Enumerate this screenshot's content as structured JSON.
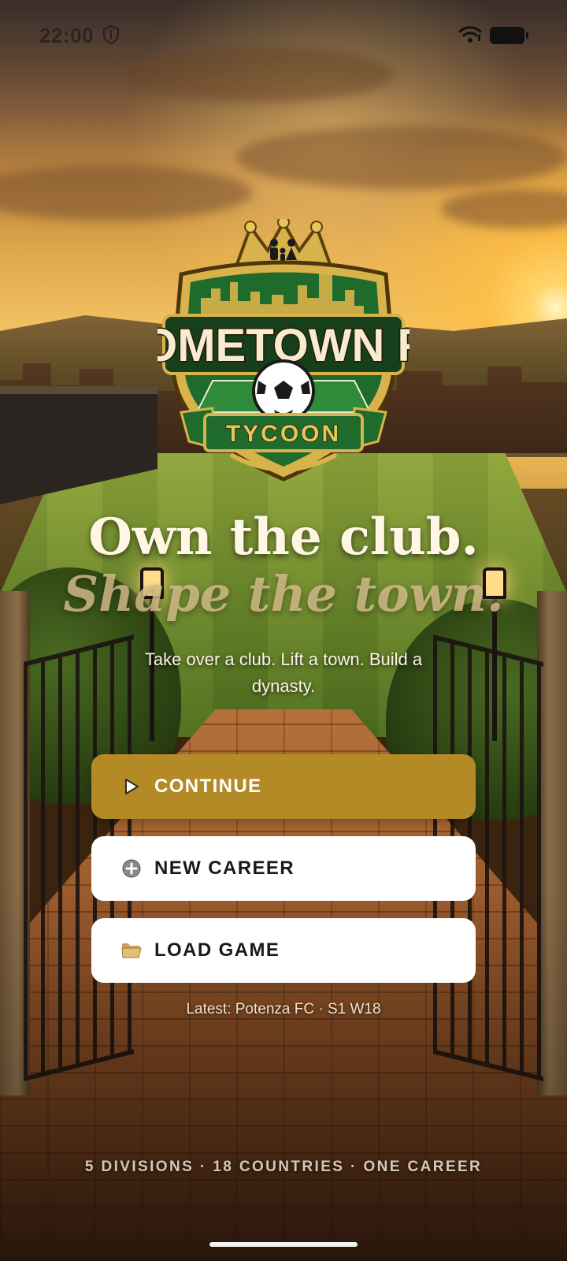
{
  "status_bar": {
    "time": "22:00",
    "icons": [
      "shield-icon",
      "wifi-icon",
      "battery-icon"
    ]
  },
  "logo": {
    "title": "HOMETOWN FC",
    "subtitle": "TYCOON",
    "colors": {
      "green": "#1f6b2c",
      "gold": "#d8b24a",
      "cream": "#f6ecd0"
    }
  },
  "hero": {
    "headline": "Own the club.",
    "subheadline": "Shape the town.",
    "tagline": "Take over a club. Lift a town. Build a dynasty."
  },
  "buttons": {
    "continue": {
      "label": "CONTINUE",
      "icon": "play-icon",
      "color": "#b48a27"
    },
    "new_career": {
      "label": "NEW CAREER",
      "icon": "plus-circle-icon"
    },
    "load_game": {
      "label": "LOAD GAME",
      "icon": "folder-icon"
    }
  },
  "latest_save": "Latest: Potenza FC · S1 W18",
  "footer_tagline": "5 DIVISIONS · 18 COUNTRIES · ONE CAREER"
}
